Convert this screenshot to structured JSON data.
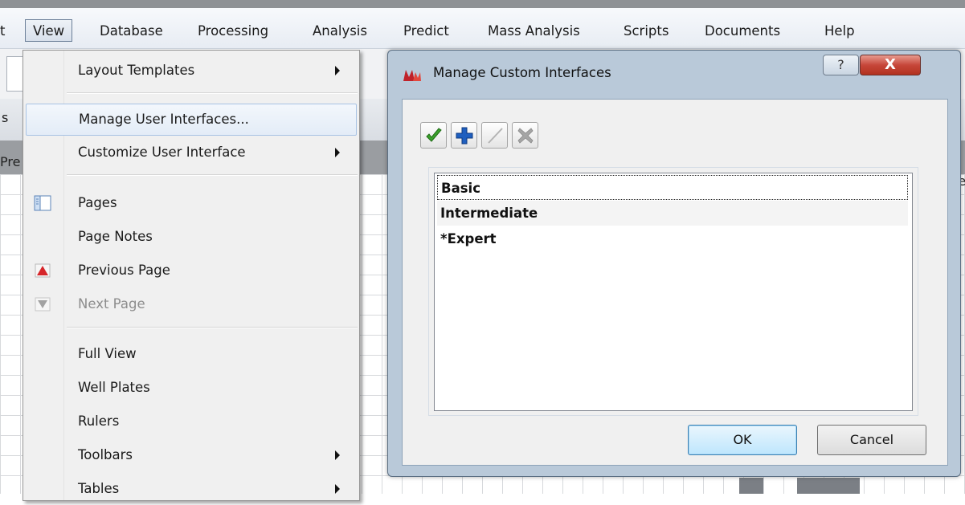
{
  "menubar": {
    "partial_left": "t",
    "items": [
      "View",
      "Database",
      "Processing",
      "Analysis",
      "Predict",
      "Mass Analysis",
      "Scripts",
      "Documents",
      "Help"
    ]
  },
  "background": {
    "left_partial_text": "Pre",
    "right_partial_text": "te",
    "tab_partial": "s"
  },
  "view_menu": {
    "items": [
      {
        "label": "Layout Templates",
        "submenu": true
      },
      {
        "label": "Manage User Interfaces...",
        "highlighted": true
      },
      {
        "label": "Customize User Interface",
        "submenu": true
      },
      {
        "label": "Pages",
        "icon": "pages-icon"
      },
      {
        "label": "Page Notes"
      },
      {
        "label": "Previous Page",
        "icon": "previous-page-icon"
      },
      {
        "label": "Next Page",
        "icon": "next-page-icon",
        "disabled": true
      },
      {
        "label": "Full View"
      },
      {
        "label": "Well Plates"
      },
      {
        "label": "Rulers"
      },
      {
        "label": "Toolbars",
        "submenu": true
      },
      {
        "label": "Tables",
        "submenu": true
      }
    ]
  },
  "dialog": {
    "title": "Manage Custom Interfaces",
    "help_label": "?",
    "close_label": "X",
    "toolbar": [
      "apply-check-icon",
      "add-plus-icon",
      "edit-pencil-icon",
      "delete-x-icon"
    ],
    "interfaces": [
      "Basic",
      "Intermediate",
      "*Expert"
    ],
    "ok_label": "OK",
    "cancel_label": "Cancel"
  },
  "colors": {
    "accent_blue": "#1f5fbf",
    "check_green": "#3aa12b",
    "menu_highlight": "#e3ecf7",
    "close_red": "#c7473a"
  }
}
